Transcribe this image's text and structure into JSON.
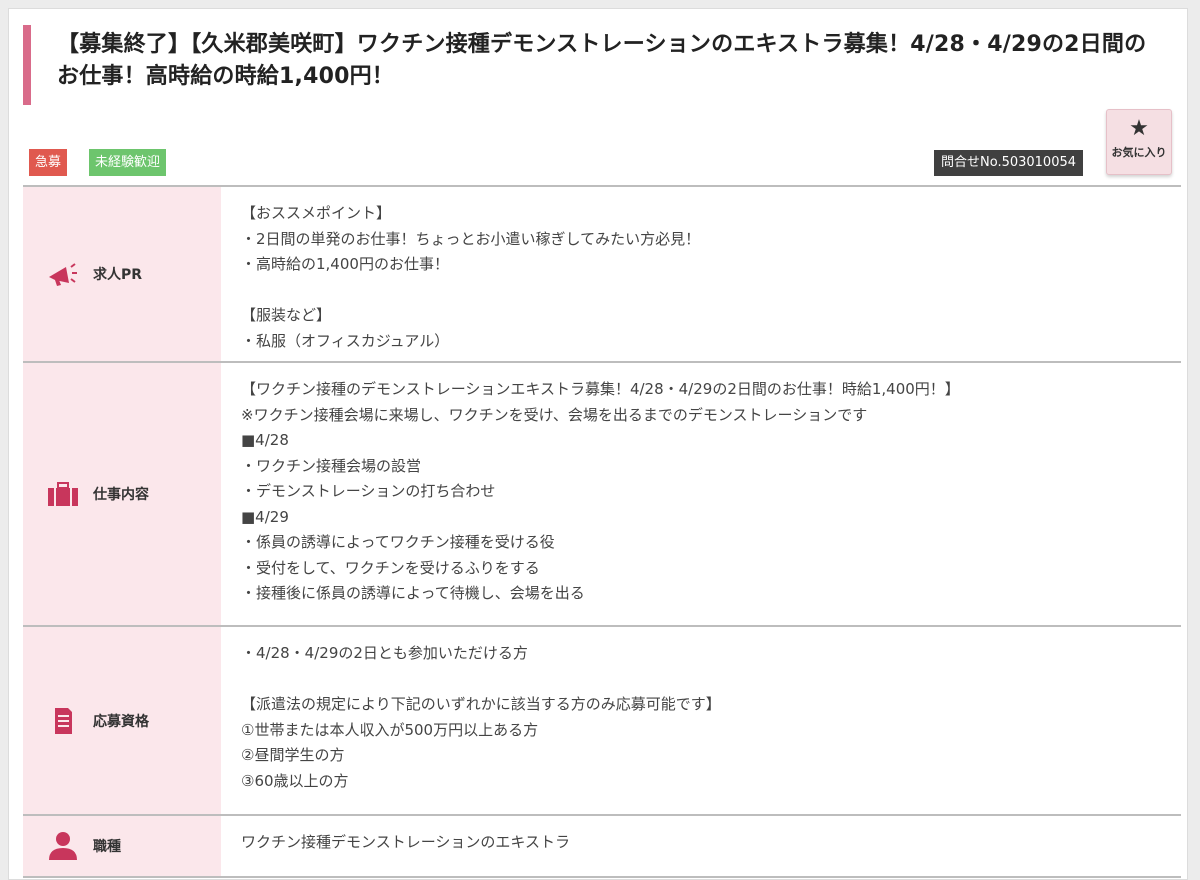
{
  "title": "【募集終了】【久米郡美咲町】ワクチン接種デモンストレーションのエキストラ募集！4/28・4/29の2日間のお仕事！高時給の時給1,400円！",
  "tags": {
    "urgent": "急募",
    "beginner": "未経験歓迎"
  },
  "inquiry_number": "問合せNo.503010054",
  "favorite": {
    "label": "お気に入り",
    "icon": "star-icon"
  },
  "colors": {
    "accent_bar": "#d96b8a",
    "header_bg": "#fbe7eb",
    "icon": "#c8365c",
    "urgent": "#e0594f",
    "beginner": "#6dc56d"
  },
  "rows": [
    {
      "label": "求人PR",
      "icon": "megaphone-icon",
      "lines": [
        "【おススメポイント】",
        "・2日間の単発のお仕事！ちょっとお小遣い稼ぎしてみたい方必見！",
        "・高時給の1,400円のお仕事！",
        "",
        "【服装など】",
        "・私服（オフィスカジュアル）"
      ]
    },
    {
      "label": "仕事内容",
      "icon": "briefcase-icon",
      "lines": [
        "【ワクチン接種のデモンストレーションエキストラ募集！4/28・4/29の2日間のお仕事！時給1,400円！】",
        "※ワクチン接種会場に来場し、ワクチンを受け、会場を出るまでのデモンストレーションです",
        "■4/28",
        "・ワクチン接種会場の設営",
        "・デモンストレーションの打ち合わせ",
        "■4/29",
        "・係員の誘導によってワクチン接種を受ける役",
        "・受付をして、ワクチンを受けるふりをする",
        "・接種後に係員の誘導によって待機し、会場を出る"
      ]
    },
    {
      "label": "応募資格",
      "icon": "document-icon",
      "lines": [
        "・4/28・4/29の2日とも参加いただける方",
        "",
        "【派遣法の規定により下記のいずれかに該当する方のみ応募可能です】",
        "①世帯または本人収入が500万円以上ある方",
        "②昼間学生の方",
        "③60歳以上の方"
      ]
    },
    {
      "label": "職種",
      "icon": "person-icon",
      "lines": [
        "ワクチン接種デモンストレーションのエキストラ"
      ]
    }
  ]
}
